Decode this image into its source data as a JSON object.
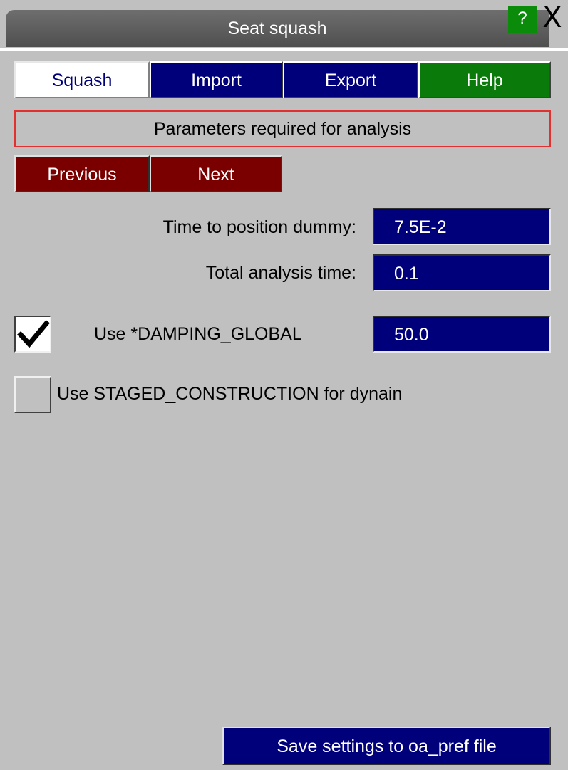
{
  "window": {
    "title": "Seat squash",
    "help_icon": "?",
    "close_icon": "X"
  },
  "tabs": [
    {
      "label": "Squash",
      "active": true
    },
    {
      "label": "Import"
    },
    {
      "label": "Export"
    },
    {
      "label": "Help"
    }
  ],
  "section": {
    "header": "Parameters required for analysis"
  },
  "navigation": {
    "previous_label": "Previous",
    "next_label": "Next"
  },
  "fields": {
    "time_to_position": {
      "label": "Time to position dummy:",
      "value": "7.5E-2"
    },
    "total_analysis_time": {
      "label": "Total analysis time:",
      "value": "0.1"
    }
  },
  "options": {
    "damping": {
      "label": "Use *DAMPING_GLOBAL",
      "checked": true,
      "value": "50.0"
    },
    "staged": {
      "label": "Use STAGED_CONSTRUCTION for dynain",
      "checked": false
    }
  },
  "footer": {
    "save_label": "Save settings to oa_pref file"
  },
  "colors": {
    "tab_blue": "#00007a",
    "tab_green": "#0a7a0a",
    "nav_red": "#7a0000",
    "header_border": "#e03030",
    "panel_grey": "#c0c0c0"
  }
}
